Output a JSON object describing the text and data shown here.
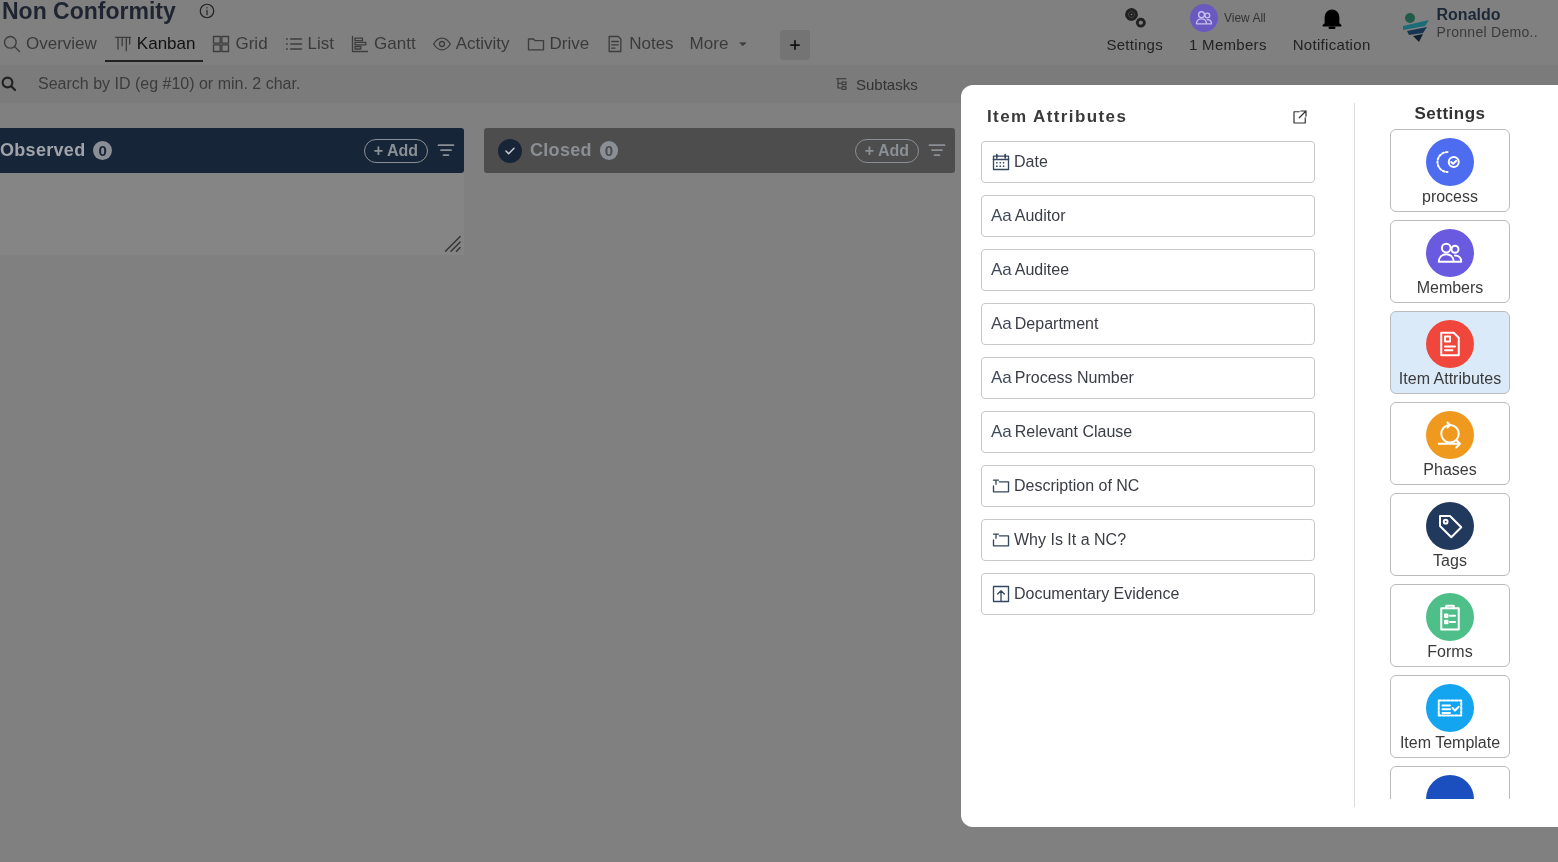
{
  "header": {
    "title": "Non Conformity"
  },
  "tabs": [
    {
      "label": "Overview",
      "kind": "overview",
      "selected": false
    },
    {
      "label": "Kanban",
      "kind": "kanban",
      "selected": true
    },
    {
      "label": "Grid",
      "kind": "grid",
      "selected": false
    },
    {
      "label": "List",
      "kind": "list",
      "selected": false
    },
    {
      "label": "Gantt",
      "kind": "gantt",
      "selected": false
    },
    {
      "label": "Activity",
      "kind": "activity",
      "selected": false
    },
    {
      "label": "Drive",
      "kind": "drive",
      "selected": false
    },
    {
      "label": "Notes",
      "kind": "notes",
      "selected": false
    },
    {
      "label": "More",
      "kind": "more",
      "selected": false
    }
  ],
  "top_actions": {
    "settings": "Settings",
    "view_all": "View All",
    "members": "1 Members",
    "notification": "Notification",
    "user": {
      "name": "Ronaldo",
      "org": "Pronnel Demo.."
    }
  },
  "search": {
    "placeholder": "Search by ID (eg #10) or min. 2 char."
  },
  "toolbar": [
    {
      "label": "Subtasks"
    }
  ],
  "columns": [
    {
      "title": "Observed",
      "count": "0",
      "add": "+ Add",
      "kind": "open"
    },
    {
      "title": "Closed",
      "count": "0",
      "add": "+ Add",
      "kind": "done"
    }
  ],
  "panel": {
    "title": "Item Attributes",
    "attributes": [
      {
        "label": "Date",
        "kind": "date"
      },
      {
        "label": "Auditor",
        "kind": "text",
        "icon": "Aa"
      },
      {
        "label": "Auditee",
        "kind": "text",
        "icon": "Aa"
      },
      {
        "label": "Department",
        "kind": "text",
        "icon": "Aa"
      },
      {
        "label": "Process Number",
        "kind": "text",
        "icon": "Aa"
      },
      {
        "label": "Relevant Clause",
        "kind": "text",
        "icon": "Aa"
      },
      {
        "label": "Description of NC",
        "kind": "textarea"
      },
      {
        "label": "Why Is It a NC?",
        "kind": "textarea"
      },
      {
        "label": "Documentary Evidence",
        "kind": "file"
      }
    ],
    "settings": {
      "title": "Settings",
      "items": [
        {
          "label": "process",
          "kind": "process",
          "color": "#4e6cf0",
          "selected": false
        },
        {
          "label": "Members",
          "kind": "members",
          "color": "#6a5ae0",
          "selected": false
        },
        {
          "label": "Item Attributes",
          "kind": "document",
          "color": "#f0463c",
          "selected": true
        },
        {
          "label": "Phases",
          "kind": "phases",
          "color": "#ef9a1e",
          "selected": false
        },
        {
          "label": "Tags",
          "kind": "tag",
          "color": "#22395e",
          "selected": false
        },
        {
          "label": "Forms",
          "kind": "clipboard",
          "color": "#4fbf8a",
          "selected": false
        },
        {
          "label": "Item Template",
          "kind": "template",
          "color": "#13a5ef",
          "selected": false
        },
        {
          "kind": "partial",
          "color": "#1b4fbf",
          "selected": false
        }
      ]
    }
  }
}
